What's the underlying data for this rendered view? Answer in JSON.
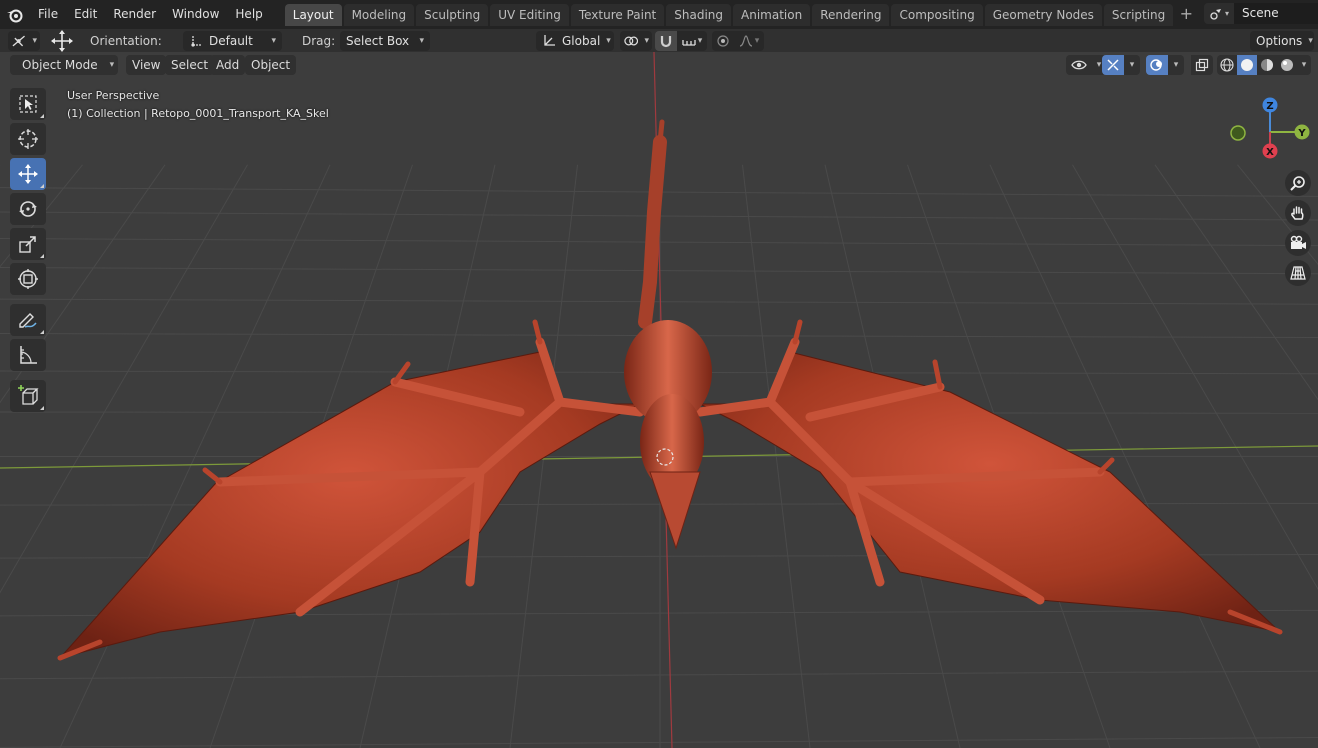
{
  "menubar": {
    "items": [
      "File",
      "Edit",
      "Render",
      "Window",
      "Help"
    ],
    "workspaces": [
      "Layout",
      "Modeling",
      "Sculpting",
      "UV Editing",
      "Texture Paint",
      "Shading",
      "Animation",
      "Rendering",
      "Compositing",
      "Geometry Nodes",
      "Scripting"
    ],
    "active_workspace": "Layout",
    "add_tab": "+",
    "scene_name": "Scene"
  },
  "tool_settings": {
    "orientation_label": "Orientation:",
    "orientation_value": "Default",
    "drag_label": "Drag:",
    "drag_value": "Select Box",
    "transform_orientation": "Global",
    "options": "Options"
  },
  "viewport_header": {
    "mode": "Object Mode",
    "menus": [
      "View",
      "Select",
      "Add",
      "Object"
    ]
  },
  "viewport": {
    "view_name": "User Perspective",
    "collection_info": "(1) Collection | Retopo_0001_Transport_KA_Skel",
    "gizmo_axes": {
      "z": "Z",
      "y": "Y",
      "x": "X"
    }
  },
  "icons": {
    "toolbar": [
      "select-box-icon",
      "cursor-icon",
      "move-icon",
      "rotate-icon",
      "scale-icon",
      "transform-icon",
      "annotate-icon",
      "measure-icon",
      "add-cube-icon"
    ],
    "navigation": [
      "zoom-icon",
      "pan-hand-icon",
      "camera-view-icon",
      "orthographic-grid-icon"
    ]
  },
  "colors": {
    "axis_x": "#c9424e",
    "axis_y": "#8fb541",
    "axis_z": "#4a8bd8",
    "active_tool": "#4772b3",
    "dragon": "#b43c22"
  }
}
